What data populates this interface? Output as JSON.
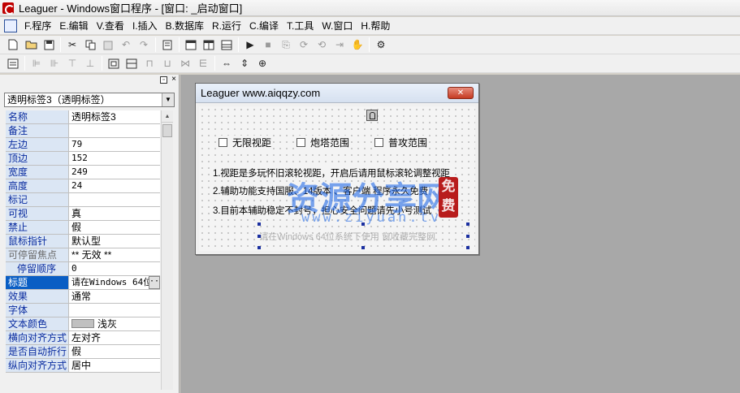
{
  "window": {
    "title": "Leaguer - Windows窗口程序 - [窗口: _启动窗口]"
  },
  "menu": [
    {
      "label": "F.程序"
    },
    {
      "label": "E.编辑"
    },
    {
      "label": "V.查看"
    },
    {
      "label": "I.插入"
    },
    {
      "label": "B.数据库"
    },
    {
      "label": "R.运行"
    },
    {
      "label": "C.编译"
    },
    {
      "label": "T.工具"
    },
    {
      "label": "W.窗口"
    },
    {
      "label": "H.帮助"
    }
  ],
  "object_selector": {
    "value": "透明标签3（透明标签）"
  },
  "properties": [
    {
      "name": "名称",
      "value": "透明标签3"
    },
    {
      "name": "备注",
      "value": ""
    },
    {
      "name": "左边",
      "value": "79"
    },
    {
      "name": "顶边",
      "value": "152"
    },
    {
      "name": "宽度",
      "value": "249"
    },
    {
      "name": "高度",
      "value": "24"
    },
    {
      "name": "标记",
      "value": ""
    },
    {
      "name": "可视",
      "value": "真"
    },
    {
      "name": "禁止",
      "value": "假"
    },
    {
      "name": "鼠标指针",
      "value": "默认型"
    },
    {
      "name": "可停留焦点",
      "value": "** 无效 **"
    },
    {
      "name": "停留顺序",
      "value": "0"
    },
    {
      "name": "标题",
      "value": "请在Windows 64位"
    },
    {
      "name": "效果",
      "value": "通常"
    },
    {
      "name": "字体",
      "value": ""
    },
    {
      "name": "文本颜色",
      "value": "浅灰"
    },
    {
      "name": "横向对齐方式",
      "value": "左对齐"
    },
    {
      "name": "是否自动折行",
      "value": "假"
    },
    {
      "name": "纵向对齐方式",
      "value": "居中"
    }
  ],
  "form": {
    "title": "Leaguer www.aiqqzy.com",
    "close_label": "✕",
    "checkboxes": [
      {
        "label": "无限视距"
      },
      {
        "label": "炮塔范围"
      },
      {
        "label": "普攻范围"
      }
    ],
    "lines": [
      "1.视距是多玩怀旧滚轮视距，开启后请用鼠标滚轮调整视距",
      "2.辅助功能支持国服、14版本 、客户端 程序永久免费",
      "3.目前本辅助稳定不封号，担心安全问题请先小号测试"
    ],
    "grey_label": "请在Windows 64位系统下使用  窗收藏完整网"
  },
  "watermark": {
    "text": "资源分享网",
    "url": "www.ziyuan.tv",
    "seal_1": "免",
    "seal_2": "费"
  },
  "colors": {
    "selected_row": "#0a5ec4",
    "property_name_bg": "#dbe6f4",
    "workspace_bg": "#a8a8a8",
    "close_button": "#c53a22"
  }
}
